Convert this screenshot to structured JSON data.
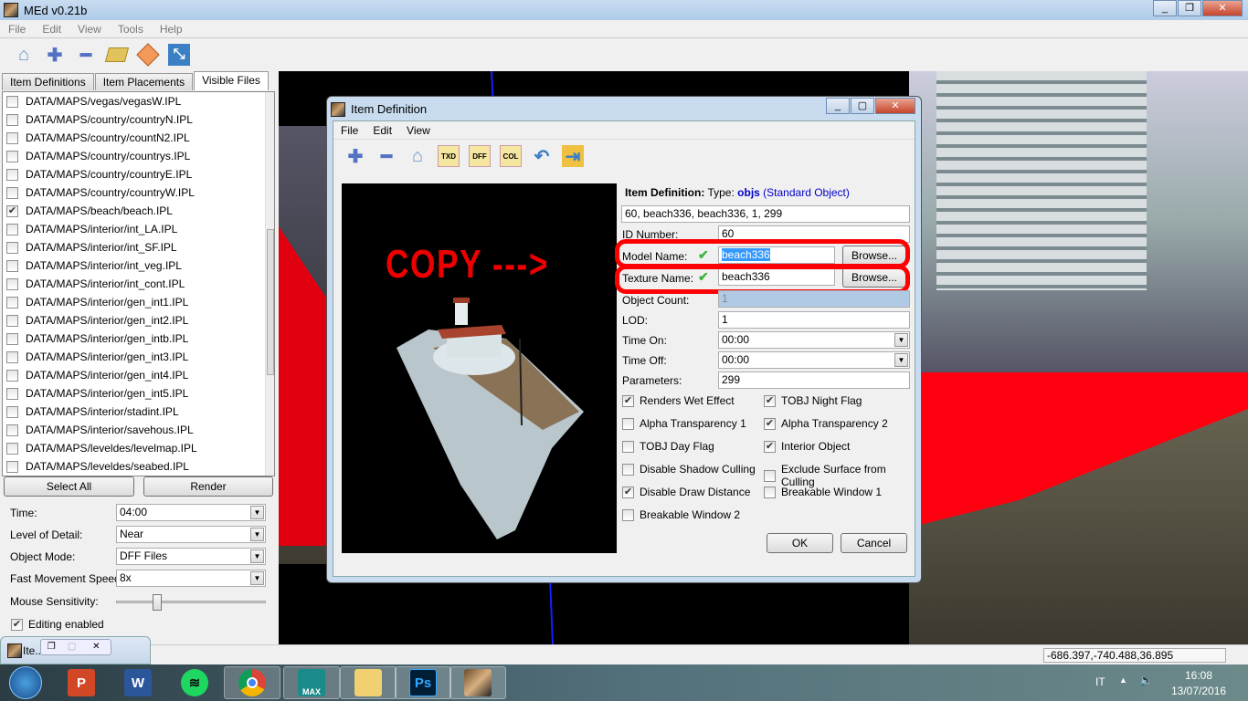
{
  "app": {
    "title": "MEd v0.21b",
    "menu": [
      "File",
      "Edit",
      "View",
      "Tools",
      "Help"
    ],
    "toolbar_icons": [
      "home-icon",
      "plus-icon",
      "minus-icon",
      "folder-open-icon",
      "tag-icon",
      "resize-icon"
    ]
  },
  "left": {
    "tabs": [
      "Item Definitions",
      "Item Placements",
      "Visible Files"
    ],
    "active_tab": "Visible Files",
    "files": [
      {
        "name": "DATA/MAPS/vegas/vegasW.IPL",
        "checked": false
      },
      {
        "name": "DATA/MAPS/country/countryN.IPL",
        "checked": false
      },
      {
        "name": "DATA/MAPS/country/countN2.IPL",
        "checked": false
      },
      {
        "name": "DATA/MAPS/country/countrys.IPL",
        "checked": false
      },
      {
        "name": "DATA/MAPS/country/countryE.IPL",
        "checked": false
      },
      {
        "name": "DATA/MAPS/country/countryW.IPL",
        "checked": false
      },
      {
        "name": "DATA/MAPS/beach/beach.IPL",
        "checked": true
      },
      {
        "name": "DATA/MAPS/interior/int_LA.IPL",
        "checked": false
      },
      {
        "name": "DATA/MAPS/interior/int_SF.IPL",
        "checked": false
      },
      {
        "name": "DATA/MAPS/interior/int_veg.IPL",
        "checked": false
      },
      {
        "name": "DATA/MAPS/interior/int_cont.IPL",
        "checked": false
      },
      {
        "name": "DATA/MAPS/interior/gen_int1.IPL",
        "checked": false
      },
      {
        "name": "DATA/MAPS/interior/gen_int2.IPL",
        "checked": false
      },
      {
        "name": "DATA/MAPS/interior/gen_intb.IPL",
        "checked": false
      },
      {
        "name": "DATA/MAPS/interior/gen_int3.IPL",
        "checked": false
      },
      {
        "name": "DATA/MAPS/interior/gen_int4.IPL",
        "checked": false
      },
      {
        "name": "DATA/MAPS/interior/gen_int5.IPL",
        "checked": false
      },
      {
        "name": "DATA/MAPS/interior/stadint.IPL",
        "checked": false
      },
      {
        "name": "DATA/MAPS/interior/savehous.IPL",
        "checked": false
      },
      {
        "name": "DATA/MAPS/leveldes/levelmap.IPL",
        "checked": false
      },
      {
        "name": "DATA/MAPS/leveldes/seabed.IPL",
        "checked": false
      }
    ],
    "select_all": "Select All",
    "render": "Render",
    "time_label": "Time:",
    "time": "04:00",
    "lod_label": "Level of Detail:",
    "lod": "Near",
    "mode_label": "Object Mode:",
    "mode": "DFF Files",
    "speed_label": "Fast Movement Speed:",
    "speed": "8x",
    "sens_label": "Mouse Sensitivity:",
    "sensitivity_fraction": 0.25,
    "editing_label": "Editing enabled",
    "editing": true
  },
  "status": {
    "coords": "-686.397,-740.488,36.895"
  },
  "mini": {
    "label": "Ite..."
  },
  "dialog": {
    "title": "Item Definition",
    "menu": [
      "File",
      "Edit",
      "View"
    ],
    "toolbar_icons": [
      "plus-icon",
      "minus-icon",
      "home-icon",
      "txd-icon",
      "dff-icon",
      "col-icon",
      "undo-icon",
      "export-icon"
    ],
    "toolbar_texts": {
      "txd": "TXD",
      "dff": "DFF",
      "col": "COL"
    },
    "annotation": "COPY --->",
    "header_bold": "Item Definition:",
    "header_type": "Type:",
    "header_objs": "objs",
    "header_std": "(Standard Object)",
    "raw": "60, beach336, beach336, 1, 299",
    "id_label": "ID Number:",
    "id": "60",
    "model_label": "Model Name:",
    "model": "beach336",
    "texture_label": "Texture Name:",
    "texture": "beach336",
    "browse": "Browse...",
    "count_label": "Object Count:",
    "count": "1",
    "lod_label": "LOD:",
    "lod": "1",
    "on_label": "Time On:",
    "on": "00:00",
    "off_label": "Time Off:",
    "off": "00:00",
    "param_label": "Parameters:",
    "param": "299",
    "flags_left": [
      {
        "label": "Renders Wet Effect",
        "checked": true
      },
      {
        "label": "Alpha Transparency 1",
        "checked": false
      },
      {
        "label": "TOBJ Day Flag",
        "checked": false
      },
      {
        "label": "Disable Shadow Culling",
        "checked": false
      },
      {
        "label": "Disable Draw Distance",
        "checked": true
      },
      {
        "label": "Breakable Window 2",
        "checked": false
      }
    ],
    "flags_right": [
      {
        "label": "TOBJ Night Flag",
        "checked": true
      },
      {
        "label": "Alpha Transparency 2",
        "checked": true
      },
      {
        "label": "Interior Object",
        "checked": true
      },
      {
        "label": "Exclude Surface from Culling",
        "checked": false
      },
      {
        "label": "Breakable Window 1",
        "checked": false
      }
    ],
    "ok": "OK",
    "cancel": "Cancel",
    "accent": "#0000cc",
    "highlight": "#ff0000"
  },
  "taskbar": {
    "apps": [
      "PowerPoint",
      "Word",
      "Spotify",
      "Chrome",
      "3ds Max",
      "Explorer",
      "Photoshop",
      "MEd"
    ],
    "max_label": "MAX",
    "ps_label": "Ps",
    "lang": "IT",
    "time": "16:08",
    "date": "13/07/2016"
  }
}
